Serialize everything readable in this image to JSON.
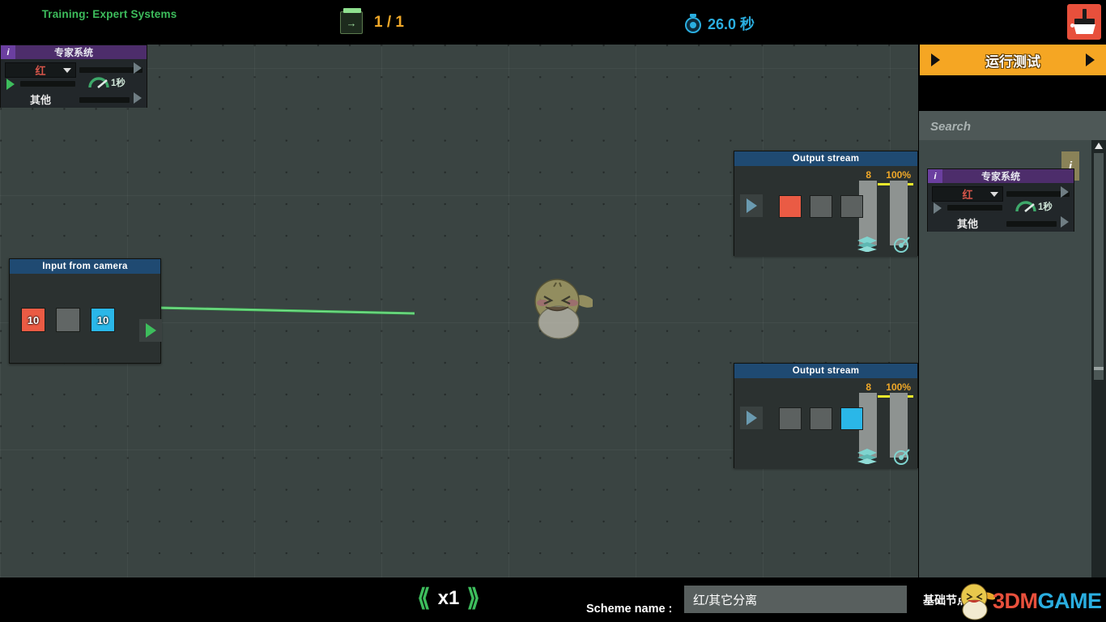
{
  "top_bar": {
    "training_title": "Training: Expert Systems",
    "level_icon": "level-export-icon",
    "level_count": "1 / 1",
    "timer_icon": "stopwatch-icon",
    "timer_text": "26.0 秒",
    "clear_button_icon": "broom-icon",
    "accent_green": "#3dbd5c",
    "accent_orange": "#f0a828",
    "accent_cyan": "#2aaee0",
    "clear_button_color": "#e8503c"
  },
  "canvas": {
    "background_color": "#3a4442",
    "nodes": {
      "camera": {
        "title": "Input from camera",
        "swatches": [
          {
            "label": "10",
            "color": "#ea5b44",
            "name": "swatch-red"
          },
          {
            "label": "",
            "color": "#616665",
            "name": "swatch-empty"
          },
          {
            "label": "10",
            "color": "#2ab7e8",
            "name": "swatch-cyan"
          }
        ],
        "output_port_icon": "play-triangle-icon"
      },
      "expert": {
        "badge": "i",
        "title": "专家系统",
        "dropdown_value": "红",
        "dropdown_color": "#d7554a",
        "other_label": "其他",
        "delay_icon": "gauge-icon",
        "delay_text": "1秒"
      },
      "output_top": {
        "title": "Output stream",
        "count": "8",
        "percent": "100%",
        "play_icon": "play-triangle-icon",
        "swatches": [
          {
            "color": "#ea5b44",
            "name": "swatch-red"
          },
          {
            "color": "#5c6160",
            "name": "swatch-empty"
          },
          {
            "color": "#5c6160",
            "name": "swatch-empty"
          }
        ],
        "layers_icon": "layers-icon",
        "target_icon": "target-icon"
      },
      "output_bottom": {
        "title": "Output stream",
        "count": "8",
        "percent": "100%",
        "play_icon": "play-triangle-icon",
        "swatches": [
          {
            "color": "#5c6160",
            "name": "swatch-empty"
          },
          {
            "color": "#5c6160",
            "name": "swatch-empty"
          },
          {
            "color": "#2ab7e8",
            "name": "swatch-cyan"
          }
        ],
        "layers_icon": "layers-icon",
        "target_icon": "target-icon"
      }
    },
    "wire_color": "#4ccc63",
    "cursor_icon": "chick-mascot-cursor"
  },
  "right_panel": {
    "run_test_label": "运行测试",
    "run_test_color": "#f5a623",
    "run_test_left_arrow": "arrow-left-icon",
    "run_test_right_arrow": "arrow-right-icon",
    "search_placeholder": "Search",
    "info_tab_label": "i",
    "palette_node": {
      "badge": "i",
      "title": "专家系统",
      "dropdown_value": "红",
      "other_label": "其他",
      "delay_icon": "gauge-icon",
      "delay_text": "1秒"
    },
    "scrollbar_up_icon": "scroll-up-arrow-icon"
  },
  "bottom_bar": {
    "speed_prev_icon": "chevron-left-icon",
    "speed_value": "x1",
    "speed_next_icon": "chevron-right-icon",
    "scheme_name_label": "Scheme name :",
    "scheme_name_value": "红/其它分离",
    "basic_nodes_label": "基础节点"
  },
  "watermark": {
    "text_a": "3DM",
    "text_b": "GAME",
    "logo_icon": "chick-logo-icon"
  }
}
